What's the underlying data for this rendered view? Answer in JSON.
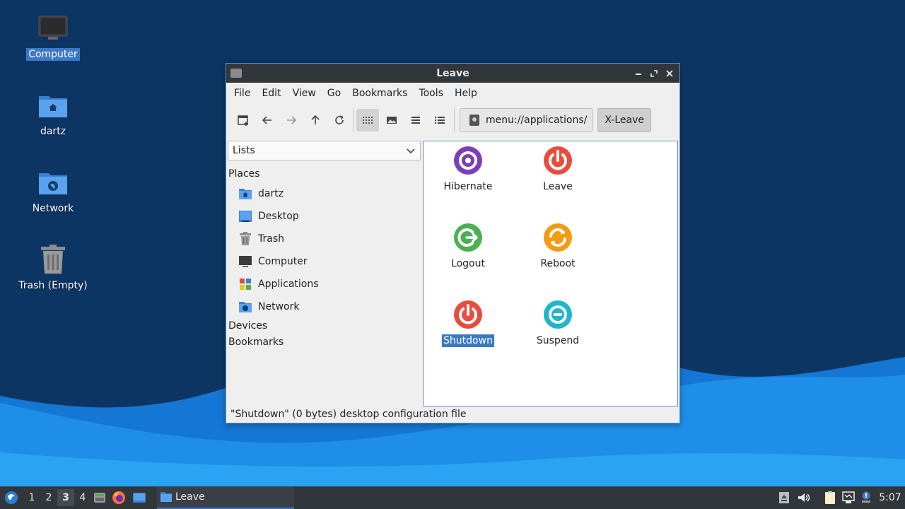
{
  "desktop": {
    "icons": [
      {
        "label": "Computer",
        "icon": "computer-icon"
      },
      {
        "label": "dartz",
        "icon": "home-folder-icon"
      },
      {
        "label": "Network",
        "icon": "network-folder-icon"
      },
      {
        "label": "Trash (Empty)",
        "icon": "trash-icon"
      }
    ]
  },
  "window": {
    "title": "Leave",
    "menu": [
      "File",
      "Edit",
      "View",
      "Go",
      "Bookmarks",
      "Tools",
      "Help"
    ],
    "path": "menu://applications/",
    "path_button": "X-Leave",
    "side": {
      "combo": "Lists",
      "places_header": "Places",
      "places": [
        {
          "label": "dartz",
          "icon": "home-folder-icon"
        },
        {
          "label": "Desktop",
          "icon": "desktop-icon"
        },
        {
          "label": "Trash",
          "icon": "trash-icon"
        },
        {
          "label": "Computer",
          "icon": "computer-icon"
        },
        {
          "label": "Applications",
          "icon": "applications-icon"
        },
        {
          "label": "Network",
          "icon": "network-folder-icon"
        }
      ],
      "devices_header": "Devices",
      "bookmarks_header": "Bookmarks"
    },
    "apps": [
      {
        "label": "Hibernate",
        "icon": "hibernate-icon",
        "color": "#7b3fb5"
      },
      {
        "label": "Leave",
        "icon": "power-icon",
        "color": "#e74c3c"
      },
      {
        "label": "Logout",
        "icon": "logout-icon",
        "color": "#4caf50"
      },
      {
        "label": "Reboot",
        "icon": "reboot-icon",
        "color": "#f39c12"
      },
      {
        "label": "Shutdown",
        "icon": "power-icon",
        "color": "#e74c3c"
      },
      {
        "label": "Suspend",
        "icon": "suspend-icon",
        "color": "#1fb6c9"
      }
    ],
    "selected_app": "Shutdown",
    "status": "\"Shutdown\" (0 bytes) desktop configuration file"
  },
  "taskbar": {
    "workspaces": [
      "1",
      "2",
      "3",
      "4"
    ],
    "active_workspace": "3",
    "task_label": "Leave",
    "clock": "5:07"
  },
  "colors": {
    "accent": "#3b78c6",
    "titlebar": "#31363b",
    "wallpaper_dark": "#0d3564",
    "wallpaper_wave": "#1e8ee8"
  }
}
